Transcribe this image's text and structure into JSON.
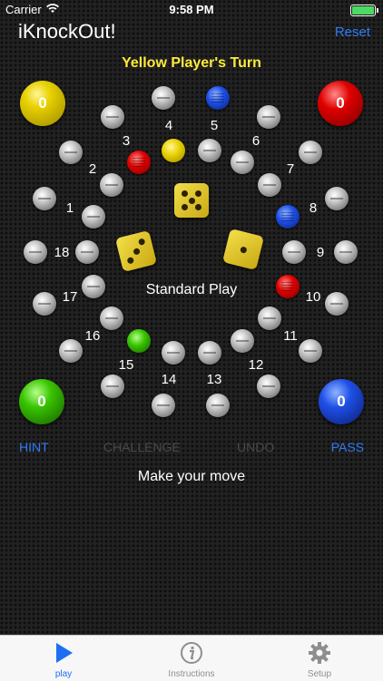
{
  "status_bar": {
    "carrier": "Carrier",
    "time": "9:58 PM"
  },
  "header": {
    "title": "iKnockOut!",
    "reset_label": "Reset",
    "turn_text": "Yellow Player's Turn"
  },
  "scores": {
    "yellow": "0",
    "red": "0",
    "green": "0",
    "blue": "0"
  },
  "board": {
    "mode": "Standard Play",
    "position_numbers": [
      "1",
      "2",
      "3",
      "4",
      "5",
      "6",
      "7",
      "8",
      "9",
      "10",
      "11",
      "12",
      "13",
      "14",
      "15",
      "16",
      "17",
      "18"
    ],
    "dice": [
      5,
      3,
      1
    ]
  },
  "actions": {
    "hint": "HINT",
    "challenge": "CHALLENGE",
    "undo": "UNDO",
    "pass": "PASS"
  },
  "message": "Make your move",
  "tabs": [
    {
      "label": "play",
      "icon": "play-icon",
      "active": true
    },
    {
      "label": "Instructions",
      "icon": "info-icon",
      "active": false
    },
    {
      "label": "Setup",
      "icon": "gear-icon",
      "active": false
    }
  ],
  "colors": {
    "accent": "#2f7cf6",
    "turn": "#ffeb3b",
    "yellow": "#e9d200",
    "red": "#e00000",
    "green": "#38c400",
    "blue": "#1f4fe8"
  }
}
